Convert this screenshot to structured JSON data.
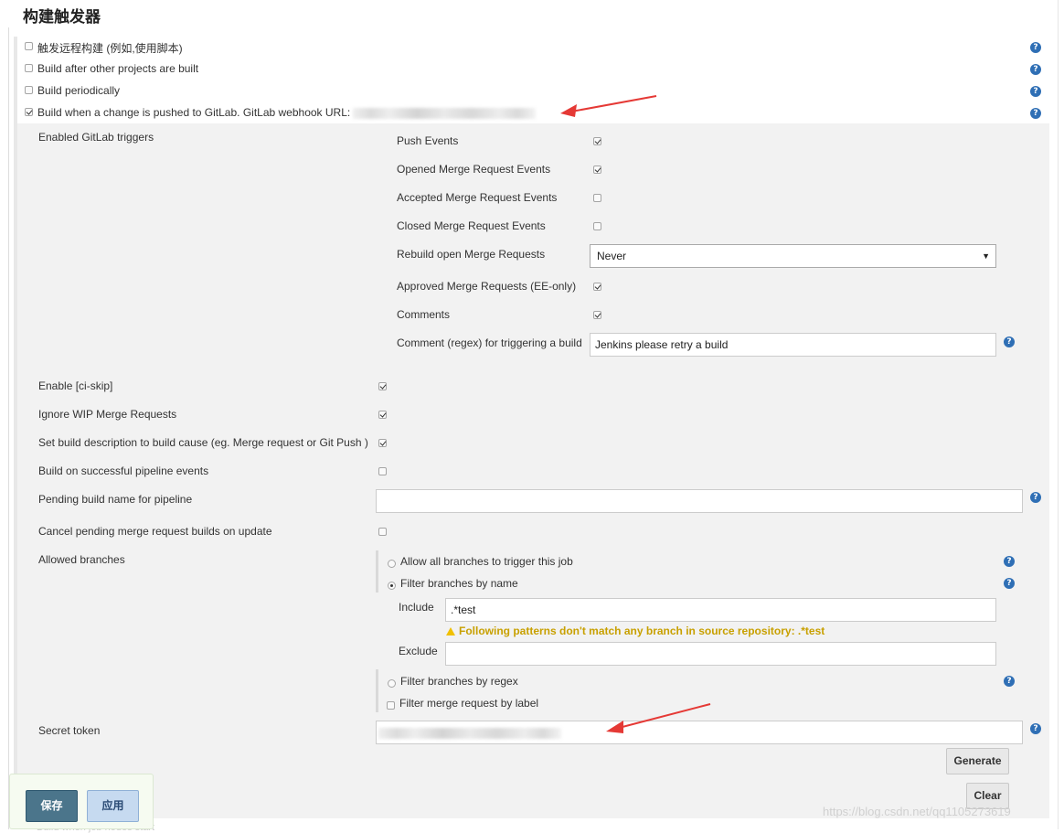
{
  "section_title": "构建触发器",
  "triggers": {
    "remote_label": "触发远程构建 (例如,使用脚本)",
    "after_other_label": "Build after other projects are built",
    "periodically_label": "Build periodically",
    "gitlab_label": "Build when a change is pushed to GitLab. GitLab webhook URL:"
  },
  "gitlab": {
    "enabled_triggers_label": "Enabled GitLab triggers",
    "push_events": "Push Events",
    "opened_mr": "Opened Merge Request Events",
    "accepted_mr": "Accepted Merge Request Events",
    "closed_mr": "Closed Merge Request Events",
    "rebuild_open_label": "Rebuild open Merge Requests",
    "rebuild_open_value": "Never",
    "approved_mr": "Approved Merge Requests (EE-only)",
    "comments": "Comments",
    "comment_regex_label": "Comment (regex) for triggering a build",
    "comment_regex_value": "Jenkins please retry a build",
    "ci_skip": "Enable [ci-skip]",
    "ignore_wip": "Ignore WIP Merge Requests",
    "set_description": "Set build description to build cause (eg. Merge request or Git Push )",
    "pipeline_events": "Build on successful pipeline events",
    "pending_name_label": "Pending build name for pipeline",
    "pending_name_value": "",
    "cancel_pending": "Cancel pending merge request builds on update",
    "allowed_branches_label": "Allowed branches",
    "allow_all": "Allow all branches to trigger this job",
    "filter_by_name": "Filter branches by name",
    "include_label": "Include",
    "include_value": ".*test",
    "warning": "Following patterns don't match any branch in source repository: .*test",
    "exclude_label": "Exclude",
    "exclude_value": "",
    "filter_by_regex": "Filter branches by regex",
    "filter_by_label": "Filter merge request by label",
    "secret_token_label": "Secret token",
    "generate_label": "Generate",
    "clear_label": "Clear"
  },
  "footer": {
    "save_label": "保存",
    "apply_label": "应用",
    "cut_text": "Build when job nodes start",
    "watermark": "https://blog.csdn.net/qq1105273619"
  },
  "icons": {
    "help": "?",
    "select_arrow": "▼"
  },
  "colors": {
    "help_icon": "#2f6fb5",
    "save_button": "#4b758b",
    "apply_button": "#c6daf0",
    "warning_text": "#c8a000",
    "annotation_arrow": "#e53935"
  }
}
